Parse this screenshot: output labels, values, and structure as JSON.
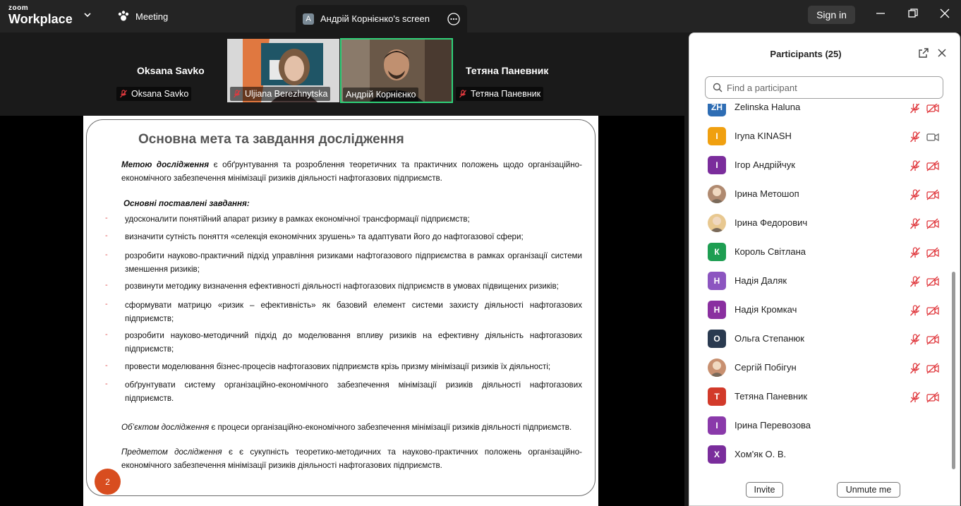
{
  "topbar": {
    "logo_line1": "zoom",
    "logo_line2": "Workplace",
    "meeting_label": "Meeting",
    "tab_badge": "A",
    "tab_title": "Андрій Корнієнко's screen",
    "signin_label": "Sign in"
  },
  "strip": {
    "left_big_name": "Oksana Savko",
    "left_label": "Oksana Savko",
    "video1_label": "Uljiana Berezhnytska",
    "video2_label": "Андрій Корнієнко",
    "right_big_name": "Тетяна Паневник",
    "right_label": "Тетяна Паневник"
  },
  "slide": {
    "title": "Основна мета та завдання дослідження",
    "goal_lead": "Метою дослідження",
    "goal_text": " є обґрунтування та розроблення теоретичних та практичних  положень щодо організаційно-економічного забезпечення мінімізації ризиків діяльності нафтогазових підприємств.",
    "tasks_heading": "Основні поставлені завдання:",
    "bullets": [
      "удосконалити понятійний апарат ризику в рамках економічної трансформації підприємств;",
      "визначити сутність поняття «селекція економічних зрушень» та адаптувати його до нафтогазової сфери;",
      "розробити науково-практичний підхід управління ризиками нафтогазового підприємства в рамках організації системи зменшення ризиків;",
      "розвинути методику визначення ефективності діяльності нафтогазових підприємств в умовах підвищених ризиків;",
      "сформувати матрицю «ризик – ефективність» як базовий елемент системи захисту діяльності нафтогазових підприємств;",
      "розробити науково-методичний підхід до моделювання впливу ризиків на ефективну діяльність нафтогазових підприємств;",
      "провести моделювання бізнес-процесів нафтогазових підприємств крізь призму мінімізації ризиків їх діяльності;",
      "обґрунтувати систему організаційно-економічного забезпечення мінімізації ризиків діяльності нафтогазових підприємств."
    ],
    "object_lead": "Об’єктом дослідження",
    "object_text": " є процеси організаційно-економічного забезпечення мінімізації ризиків діяльності підприємств.",
    "subject_lead": "Предметом дослідження",
    "subject_text": " є є сукупність теоретико-методичних та науково-практичних положень організаційно-економічного забезпечення мінімізації ризиків діяльності нафтогазових підприємств.",
    "page_number": "2"
  },
  "panel": {
    "title": "Participants (25)",
    "search_placeholder": "Find a participant",
    "invite_label": "Invite",
    "unmute_label": "Unmute me",
    "participants": [
      {
        "initials": "ZH",
        "name": "Zelinska Haluna",
        "color": "#2e6db4",
        "photo": false,
        "mic": "off",
        "cam": "off"
      },
      {
        "initials": "I",
        "name": "Iryna KINASH",
        "color": "#f0a010",
        "photo": false,
        "mic": "off",
        "cam": "on"
      },
      {
        "initials": "І",
        "name": "Ігор Андрійчук",
        "color": "#7b2d9c",
        "photo": false,
        "mic": "off",
        "cam": "off"
      },
      {
        "initials": "",
        "name": "Ірина Метошоп",
        "color": "#b08a70",
        "photo": true,
        "mic": "off",
        "cam": "off"
      },
      {
        "initials": "",
        "name": "Ірина Федорович",
        "color": "#e8c890",
        "photo": true,
        "mic": "off",
        "cam": "off"
      },
      {
        "initials": "К",
        "name": "Король Світлана",
        "color": "#1e9e52",
        "photo": false,
        "mic": "off",
        "cam": "off"
      },
      {
        "initials": "Н",
        "name": "Надія Даляк",
        "color": "#8c55c0",
        "photo": false,
        "mic": "off",
        "cam": "off"
      },
      {
        "initials": "Н",
        "name": "Надія Кромкач",
        "color": "#8a2fa0",
        "photo": false,
        "mic": "off",
        "cam": "off"
      },
      {
        "initials": "О",
        "name": "Ольга Степанюк",
        "color": "#2a3a50",
        "photo": false,
        "mic": "off",
        "cam": "off"
      },
      {
        "initials": "",
        "name": "Сергій Побігун",
        "color": "#c89070",
        "photo": true,
        "mic": "off",
        "cam": "off"
      },
      {
        "initials": "Т",
        "name": "Тетяна Паневник",
        "color": "#d23a2a",
        "photo": false,
        "mic": "off",
        "cam": "off"
      },
      {
        "initials": "І",
        "name": "Ірина Перевозова",
        "color": "#8a3aaa",
        "photo": false,
        "mic": "none",
        "cam": "none"
      },
      {
        "initials": "Х",
        "name": "Хом'як О. В.",
        "color": "#7a2d9c",
        "photo": false,
        "mic": "none",
        "cam": "none"
      }
    ]
  }
}
